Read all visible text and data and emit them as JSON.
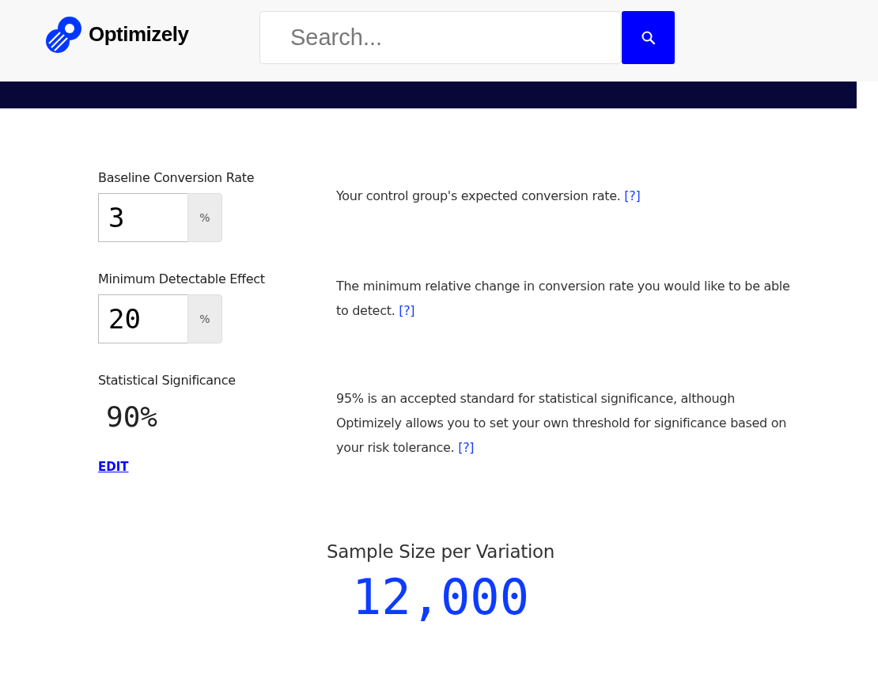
{
  "header": {
    "logo_text": "Optimizely",
    "search": {
      "placeholder": "Search..."
    }
  },
  "fields": [
    {
      "kind": "input",
      "label": "Baseline Conversion Rate",
      "value": "3",
      "unit": "%",
      "description": "Your control group's expected conversion rate.",
      "help": "[?]"
    },
    {
      "kind": "input",
      "label": "Minimum Detectable Effect",
      "value": "20",
      "unit": "%",
      "description": "The minimum relative change in conversion rate you would like to be able to detect.",
      "help": "[?]"
    },
    {
      "kind": "display",
      "label": "Statistical Significance",
      "value": "90%",
      "edit": "EDIT",
      "description": "95% is an accepted standard for statistical significance, although Optimizely allows you to set your own threshold for significance based on your risk tolerance.",
      "help": "[?]"
    }
  ],
  "result": {
    "label": "Sample Size per Variation",
    "value": "12,000"
  }
}
